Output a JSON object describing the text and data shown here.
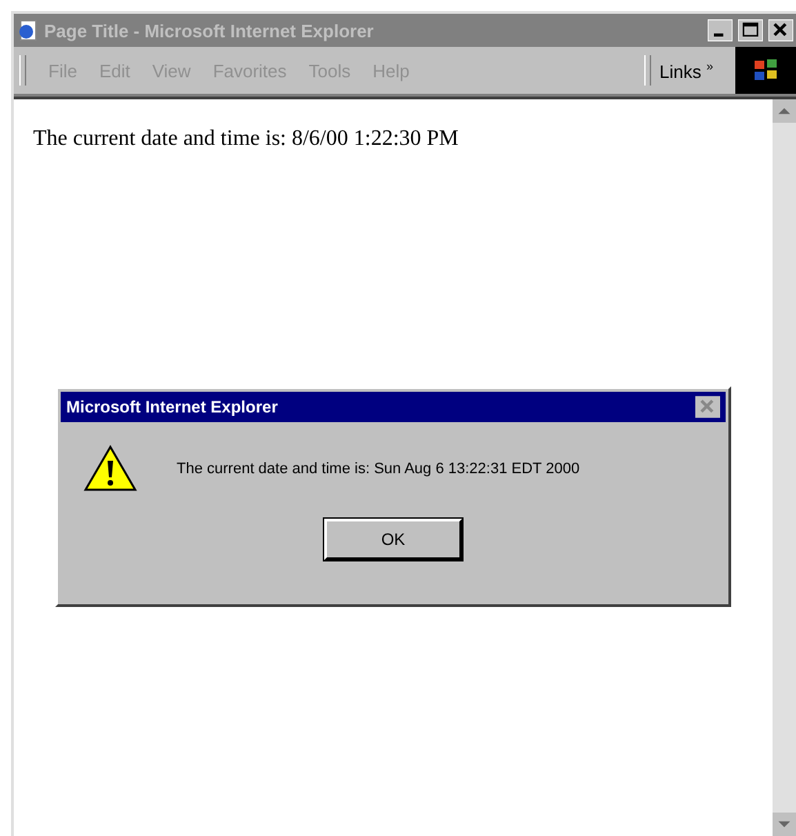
{
  "window": {
    "title": "Page Title - Microsoft Internet Explorer"
  },
  "menu": [
    "File",
    "Edit",
    "View",
    "Favorites",
    "Tools",
    "Help"
  ],
  "links": {
    "label": "Links",
    "chevron": "»"
  },
  "page": {
    "text": "The current date and time is: 8/6/00 1:22:30 PM"
  },
  "dialog": {
    "title": "Microsoft Internet Explorer",
    "message": "The current date and time is: Sun Aug 6 13:22:31 EDT 2000",
    "button": "OK"
  }
}
